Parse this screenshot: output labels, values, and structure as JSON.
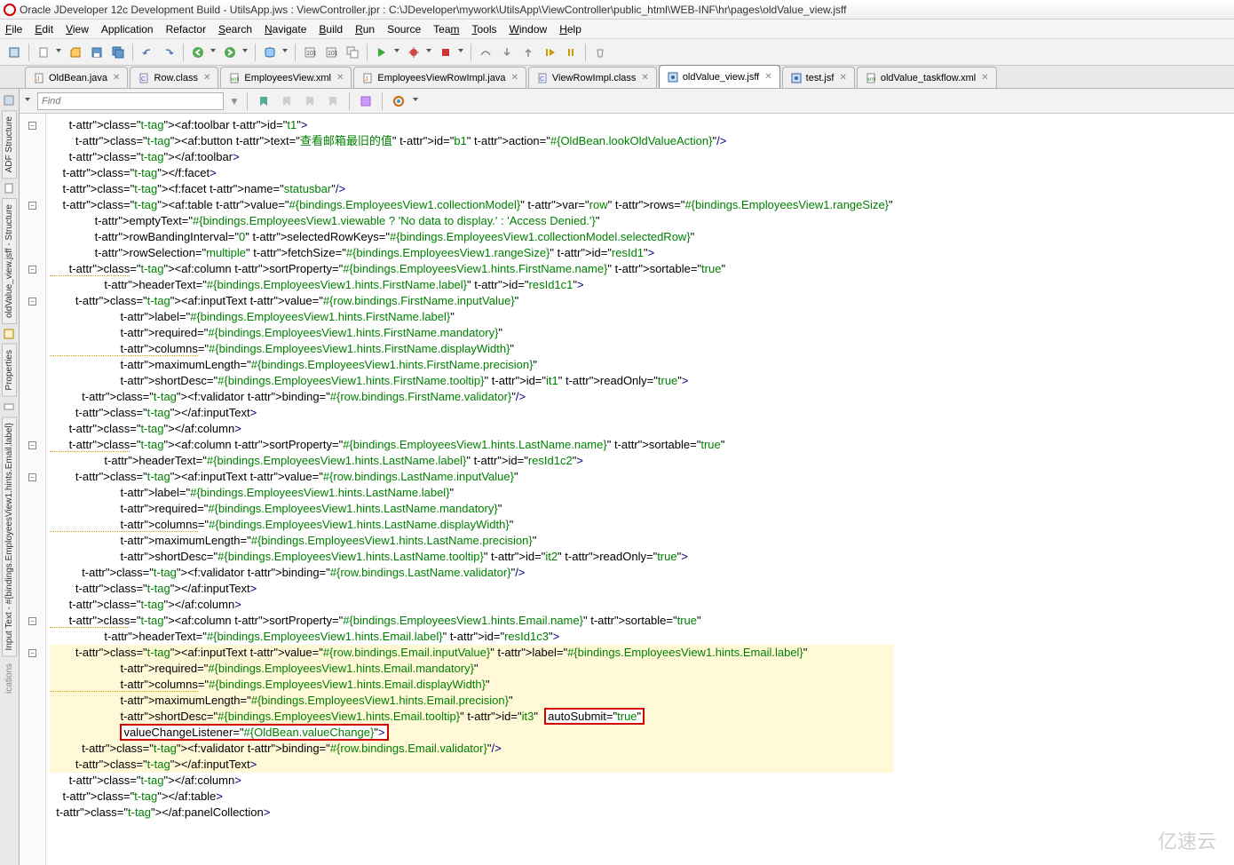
{
  "window": {
    "title": "Oracle JDeveloper 12c Development Build - UtilsApp.jws : ViewController.jpr : C:\\JDeveloper\\mywork\\UtilsApp\\ViewController\\public_html\\WEB-INF\\hr\\pages\\oldValue_view.jsff"
  },
  "menu": {
    "file": "File",
    "edit": "Edit",
    "view": "View",
    "application": "Application",
    "refactor": "Refactor",
    "search": "Search",
    "navigate": "Navigate",
    "build": "Build",
    "run": "Run",
    "source": "Source",
    "team": "Team",
    "tools": "Tools",
    "window": "Window",
    "help": "Help"
  },
  "tabs": [
    {
      "icon": "java",
      "label": "OldBean.java"
    },
    {
      "icon": "class",
      "label": "Row.class"
    },
    {
      "icon": "xml",
      "label": "EmployeesView.xml"
    },
    {
      "icon": "java",
      "label": "EmployeesViewRowImpl.java"
    },
    {
      "icon": "class",
      "label": "ViewRowImpl.class"
    },
    {
      "icon": "jsf",
      "label": "oldValue_view.jsff",
      "active": true
    },
    {
      "icon": "jsf",
      "label": "test.jsf"
    },
    {
      "icon": "xml",
      "label": "oldValue_taskflow.xml"
    }
  ],
  "find": {
    "placeholder": "Find"
  },
  "sidebar": {
    "structure": "ADF Structure",
    "file": "oldValue_view.jsff - Structure",
    "properties": "Properties",
    "inputtext": "Input Text - #{bindings.EmployeesView1.hints.Email.label}"
  },
  "watermark": "亿速云",
  "code": {
    "lines": [
      {
        "ind": 8,
        "c": "      <af:toolbar id=\"t1\">",
        "fold": "-"
      },
      {
        "ind": 8,
        "c": "        <af:button text=\"查看邮箱最旧的值\" id=\"b1\" action=\"#{OldBean.lookOldValueAction}\"/>"
      },
      {
        "ind": 8,
        "c": "      </af:toolbar>"
      },
      {
        "ind": 6,
        "c": "    </f:facet>"
      },
      {
        "ind": 6,
        "c": "    <f:facet name=\"statusbar\"/>"
      },
      {
        "ind": 6,
        "c": "    <af:table value=\"#{bindings.EmployeesView1.collectionModel}\" var=\"row\" rows=\"#{bindings.EmployeesView1.rangeSize}\"",
        "fold": "-"
      },
      {
        "ind": 6,
        "c": "              emptyText=\"#{bindings.EmployeesView1.viewable ? 'No data to display.' : 'Access Denied.'}\""
      },
      {
        "ind": 6,
        "c": "              rowBandingInterval=\"0\" selectedRowKeys=\"#{bindings.EmployeesView1.collectionModel.selectedRow}\""
      },
      {
        "ind": 6,
        "c": "              rowSelection=\"multiple\" fetchSize=\"#{bindings.EmployeesView1.rangeSize}\" id=\"resId1\">"
      },
      {
        "ind": 8,
        "c": "      <af:column sortProperty=\"#{bindings.EmployeesView1.hints.FirstName.name}\" sortable=\"true\"",
        "fold": "-",
        "dotted": true
      },
      {
        "ind": 8,
        "c": "                 headerText=\"#{bindings.EmployeesView1.hints.FirstName.label}\" id=\"resId1c1\">"
      },
      {
        "ind": 10,
        "c": "        <af:inputText value=\"#{row.bindings.FirstName.inputValue}\"",
        "fold": "-"
      },
      {
        "ind": 10,
        "c": "                      label=\"#{bindings.EmployeesView1.hints.FirstName.label}\""
      },
      {
        "ind": 10,
        "c": "                      required=\"#{bindings.EmployeesView1.hints.FirstName.mandatory}\""
      },
      {
        "ind": 10,
        "c": "                      columns=\"#{bindings.EmployeesView1.hints.FirstName.displayWidth}\"",
        "dotted": true
      },
      {
        "ind": 10,
        "c": "                      maximumLength=\"#{bindings.EmployeesView1.hints.FirstName.precision}\""
      },
      {
        "ind": 10,
        "c": "                      shortDesc=\"#{bindings.EmployeesView1.hints.FirstName.tooltip}\" id=\"it1\" readOnly=\"true\">"
      },
      {
        "ind": 10,
        "c": "          <f:validator binding=\"#{row.bindings.FirstName.validator}\"/>"
      },
      {
        "ind": 10,
        "c": "        </af:inputText>"
      },
      {
        "ind": 8,
        "c": "      </af:column>"
      },
      {
        "ind": 8,
        "c": "      <af:column sortProperty=\"#{bindings.EmployeesView1.hints.LastName.name}\" sortable=\"true\"",
        "fold": "-",
        "dotted": true
      },
      {
        "ind": 8,
        "c": "                 headerText=\"#{bindings.EmployeesView1.hints.LastName.label}\" id=\"resId1c2\">"
      },
      {
        "ind": 10,
        "c": "        <af:inputText value=\"#{row.bindings.LastName.inputValue}\"",
        "fold": "-"
      },
      {
        "ind": 10,
        "c": "                      label=\"#{bindings.EmployeesView1.hints.LastName.label}\""
      },
      {
        "ind": 10,
        "c": "                      required=\"#{bindings.EmployeesView1.hints.LastName.mandatory}\""
      },
      {
        "ind": 10,
        "c": "                      columns=\"#{bindings.EmployeesView1.hints.LastName.displayWidth}\"",
        "dotted": true
      },
      {
        "ind": 10,
        "c": "                      maximumLength=\"#{bindings.EmployeesView1.hints.LastName.precision}\""
      },
      {
        "ind": 10,
        "c": "                      shortDesc=\"#{bindings.EmployeesView1.hints.LastName.tooltip}\" id=\"it2\" readOnly=\"true\">"
      },
      {
        "ind": 10,
        "c": "          <f:validator binding=\"#{row.bindings.LastName.validator}\"/>"
      },
      {
        "ind": 10,
        "c": "        </af:inputText>"
      },
      {
        "ind": 8,
        "c": "      </af:column>"
      },
      {
        "ind": 8,
        "c": "      <af:column sortProperty=\"#{bindings.EmployeesView1.hints.Email.name}\" sortable=\"true\"",
        "fold": "-",
        "dotted": true
      },
      {
        "ind": 8,
        "c": "                 headerText=\"#{bindings.EmployeesView1.hints.Email.label}\" id=\"resId1c3\">"
      },
      {
        "ind": 10,
        "c": "        <af:inputText value=\"#{row.bindings.Email.inputValue}\" label=\"#{bindings.EmployeesView1.hints.Email.label}\"",
        "fold": "-",
        "hl": true
      },
      {
        "ind": 10,
        "c": "                      required=\"#{bindings.EmployeesView1.hints.Email.mandatory}\"",
        "hl": true
      },
      {
        "ind": 10,
        "c": "                      columns=\"#{bindings.EmployeesView1.hints.Email.displayWidth}\"",
        "hl": true,
        "dotted": true
      },
      {
        "ind": 10,
        "c": "                      maximumLength=\"#{bindings.EmployeesView1.hints.Email.precision}\"",
        "hl": true
      },
      {
        "ind": 10,
        "c": "                      shortDesc=\"#{bindings.EmployeesView1.hints.Email.tooltip}\" id=\"it3\" ",
        "hl": true,
        "redbox1": "autoSubmit=\"true\""
      },
      {
        "ind": 10,
        "c": "                      ",
        "hl": true,
        "redbox2": "valueChangeListener=\"#{OldBean.valueChange}\">"
      },
      {
        "ind": 10,
        "c": "          <f:validator binding=\"#{row.bindings.Email.validator}\"/>",
        "hl": true
      },
      {
        "ind": 10,
        "c": "        </af:inputText>",
        "hl": true
      },
      {
        "ind": 8,
        "c": "      </af:column>"
      },
      {
        "ind": 6,
        "c": "    </af:table>"
      },
      {
        "ind": 4,
        "c": "  </af:panelCollection>"
      }
    ]
  }
}
